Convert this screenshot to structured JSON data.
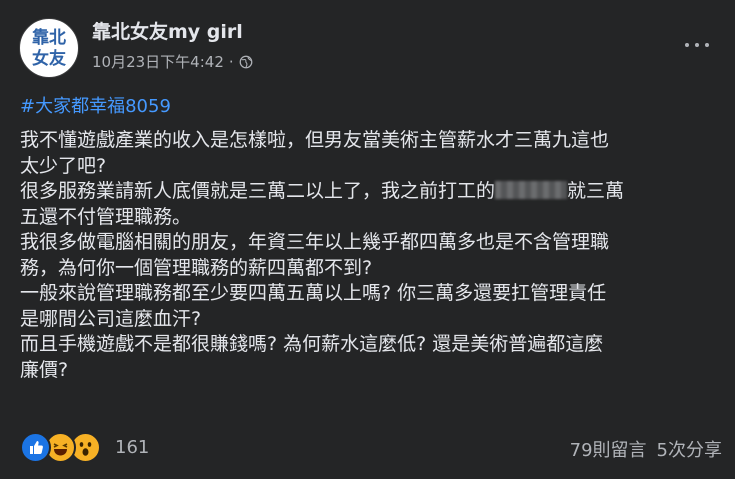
{
  "header": {
    "avatar_line1": "靠北",
    "avatar_line2": "女友",
    "page_name": "靠北女友my girl",
    "timestamp": "10月23日下午4:42",
    "separator": "·",
    "privacy_icon": "globe-icon"
  },
  "post": {
    "hashtag": "#大家都幸福8059",
    "lines": [
      "我不懂遊戲產業的收入是怎樣啦，但男友當美術主管薪水才三萬九這也",
      "太少了吧?",
      "很多服務業請新人底價就是三萬二以上了，我之前打工的",
      "就三萬",
      "五還不付管理職務。",
      "我很多做電腦相關的朋友，年資三年以上幾乎都四萬多也是不含管理職",
      "務，為何你一個管理職務的薪四萬都不到?",
      "一般來說管理職務都至少要四萬五萬以上嗎? 你三萬多還要扛管理責任",
      "是哪間公司這麼血汗?",
      "而且手機遊戲不是都很賺錢嗎? 為何薪水這麼低? 還是美術普遍都這麼",
      "廉價?"
    ]
  },
  "footer": {
    "reaction_icons": [
      "like-icon",
      "haha-icon",
      "wow-icon"
    ],
    "reaction_count": "161",
    "comments": "79則留言",
    "shares": "5次分享"
  },
  "colors": {
    "background": "#242526",
    "text": "#e4e6eb",
    "secondary_text": "#b0b3b8",
    "hashtag": "#4599ff",
    "like_blue": "#1b74e4",
    "emoji_yellow": "#f7b125"
  }
}
